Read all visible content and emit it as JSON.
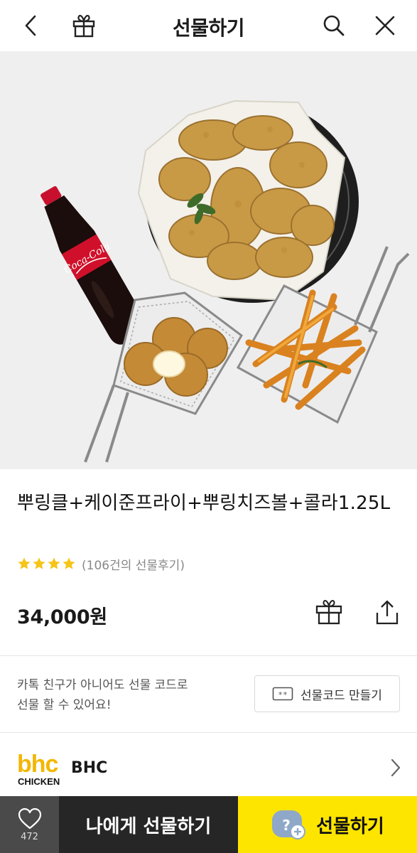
{
  "header": {
    "title": "선물하기",
    "back_icon": "chevron-left-icon",
    "gift_icon": "gift-icon",
    "search_icon": "search-icon",
    "close_icon": "close-icon"
  },
  "hero": {
    "bottle_label": "Coca-Cola"
  },
  "product": {
    "title": "뿌링클+케이준프라이+뿌링치즈볼+콜라1.25L",
    "rating_stars": 4,
    "review_text": "(106건의 선물후기)",
    "price": "34,000원"
  },
  "gift_code": {
    "description_line1": "카톡 친구가 아니어도 선물 코드로",
    "description_line2": "선물 할 수 있어요!",
    "button_label": "선물코드 만들기"
  },
  "brand": {
    "logo_top": "bhc",
    "logo_bottom": "CHICKEN",
    "name": "BHC"
  },
  "bottom_bar": {
    "like_count": "472",
    "to_me_label": "나에게 선물하기",
    "gift_label": "선물하기"
  },
  "colors": {
    "accent_yellow": "#fde500",
    "star": "#f5c518",
    "dark_button": "#262626",
    "like_button": "#4a4a4a"
  }
}
